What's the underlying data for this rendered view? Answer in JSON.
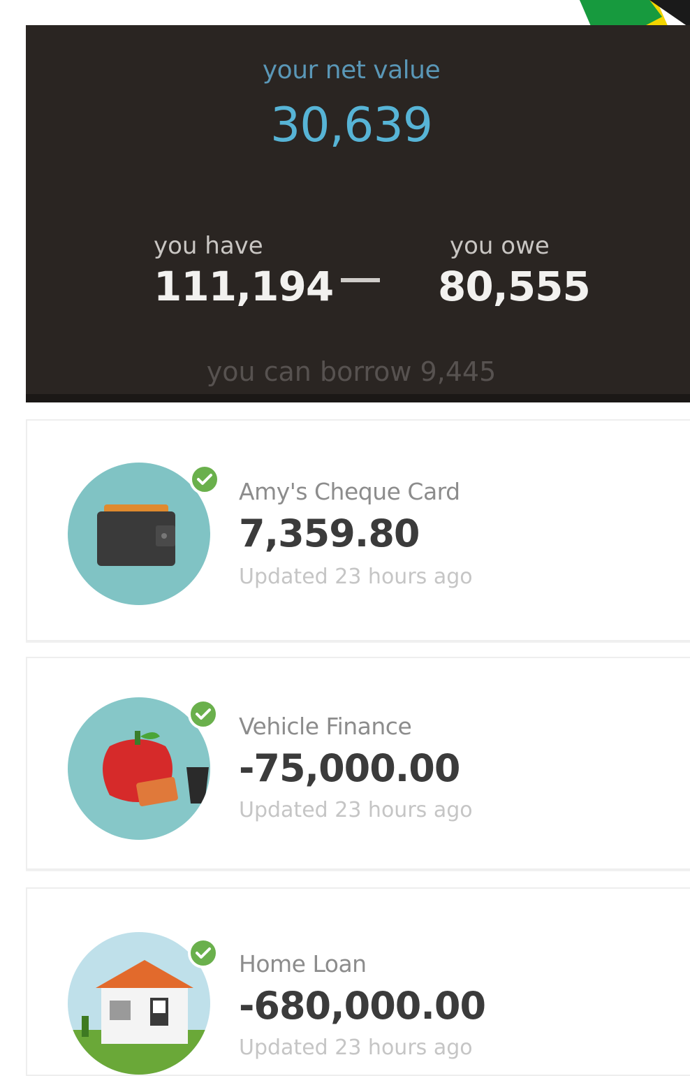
{
  "summary": {
    "net_value_label": "your net value",
    "net_value": "30,639",
    "have_label": "you have",
    "have_value": "111,194",
    "owe_label": "you owe",
    "owe_value": "80,555",
    "borrow_text": "you can borrow 9,445"
  },
  "accounts": [
    {
      "name": "Amy's Cheque Card",
      "amount": "7,359.80",
      "updated": "Updated 23 hours ago",
      "icon": "wallet-icon"
    },
    {
      "name": "Vehicle Finance",
      "amount": "-75,000.00",
      "updated": "Updated 23 hours ago",
      "icon": "vehicle-finance-icon"
    },
    {
      "name": "Home Loan",
      "amount": "-680,000.00",
      "updated": "Updated 23 hours ago",
      "icon": "house-icon"
    }
  ],
  "colors": {
    "summary_bg": "#2a2522",
    "net_value": "#57b4d6",
    "check_green": "#6ab04c",
    "avatar_teal": "#80c3c4"
  }
}
